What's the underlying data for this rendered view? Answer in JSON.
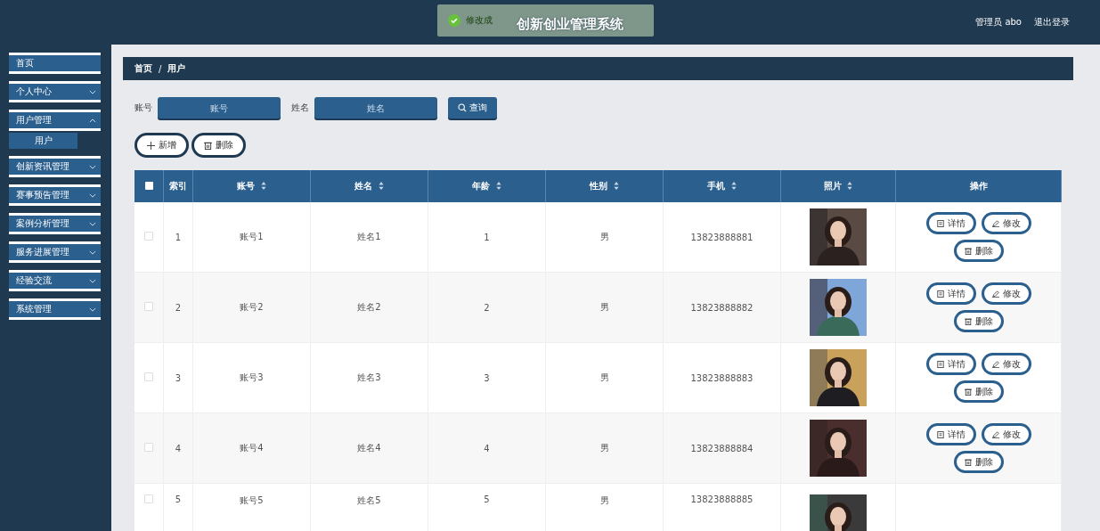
{
  "header": {
    "title": "创新创业管理系统",
    "user": "管理员 abo",
    "logout": "退出登录"
  },
  "toast": {
    "message": "修改成"
  },
  "sidebar": {
    "items": [
      {
        "label": "首页",
        "kind": "link"
      },
      {
        "label": "个人中心",
        "kind": "menu",
        "expanded": false
      },
      {
        "label": "用户管理",
        "kind": "menu",
        "expanded": true,
        "children": [
          {
            "label": "用户",
            "selected": true
          }
        ]
      },
      {
        "label": "创新资讯管理",
        "kind": "menu",
        "expanded": false
      },
      {
        "label": "赛事预告管理",
        "kind": "menu",
        "expanded": false
      },
      {
        "label": "案例分析管理",
        "kind": "menu",
        "expanded": false
      },
      {
        "label": "服务进展管理",
        "kind": "menu",
        "expanded": false
      },
      {
        "label": "经验交流",
        "kind": "menu",
        "expanded": false
      },
      {
        "label": "系统管理",
        "kind": "menu",
        "expanded": false
      }
    ]
  },
  "breadcrumb": {
    "separator": "/",
    "items": [
      "首页",
      "用户"
    ]
  },
  "search": {
    "fields": [
      {
        "label": "账号",
        "placeholder": "账号"
      },
      {
        "label": "姓名",
        "placeholder": "姓名"
      }
    ],
    "button": "查询"
  },
  "actions": {
    "add": "新增",
    "delete": "删除"
  },
  "table": {
    "select_all_checked": false,
    "columns": [
      {
        "label": "索引",
        "sortable": false
      },
      {
        "label": "账号",
        "sortable": true
      },
      {
        "label": "姓名",
        "sortable": true
      },
      {
        "label": "年龄",
        "sortable": true
      },
      {
        "label": "性别",
        "sortable": true
      },
      {
        "label": "手机",
        "sortable": true
      },
      {
        "label": "照片",
        "sortable": true
      },
      {
        "label": "操作",
        "sortable": false
      }
    ],
    "rows": [
      {
        "checked": false,
        "cells": [
          "1",
          "账号1",
          "姓名1",
          "1",
          "男",
          "13823888881"
        ],
        "buttons": [
          {
            "kind": "detail",
            "label": "详情"
          },
          {
            "kind": "edit",
            "label": "修改"
          },
          {
            "kind": "delete",
            "label": "删除"
          }
        ]
      },
      {
        "checked": false,
        "cells": [
          "2",
          "账号2",
          "姓名2",
          "2",
          "男",
          "13823888882"
        ],
        "buttons": [
          {
            "kind": "detail",
            "label": "详情"
          },
          {
            "kind": "edit",
            "label": "修改"
          },
          {
            "kind": "delete",
            "label": "删除"
          }
        ]
      },
      {
        "checked": false,
        "cells": [
          "3",
          "账号3",
          "姓名3",
          "3",
          "男",
          "13823888883"
        ],
        "buttons": [
          {
            "kind": "detail",
            "label": "详情"
          },
          {
            "kind": "edit",
            "label": "修改"
          },
          {
            "kind": "delete",
            "label": "删除"
          }
        ]
      },
      {
        "checked": false,
        "cells": [
          "4",
          "账号4",
          "姓名4",
          "4",
          "男",
          "13823888884"
        ],
        "buttons": [
          {
            "kind": "detail",
            "label": "详情"
          },
          {
            "kind": "edit",
            "label": "修改"
          },
          {
            "kind": "delete",
            "label": "删除"
          }
        ]
      },
      {
        "checked": false,
        "cells": [
          "5",
          "账号5",
          "姓名5",
          "5",
          "男",
          "13823888885"
        ]
      }
    ]
  }
}
